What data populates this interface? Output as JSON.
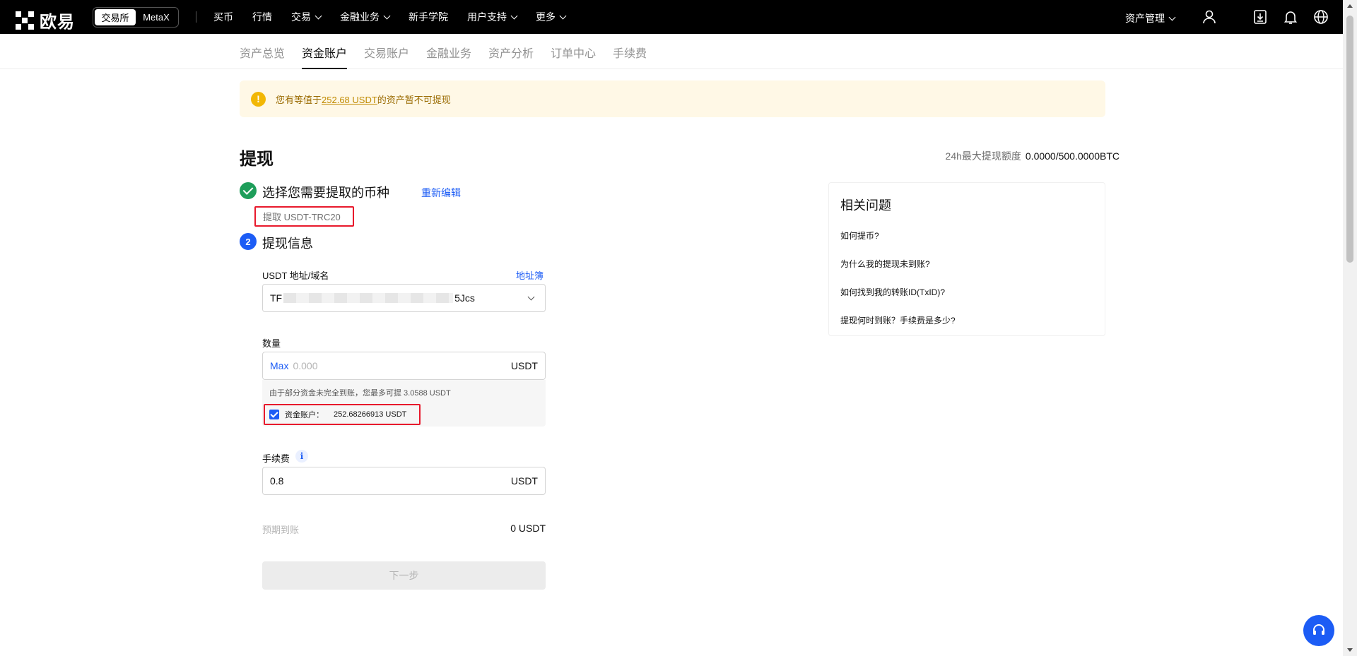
{
  "topnav": {
    "brand": "欧易",
    "switcher": [
      "交易所",
      "MetaX"
    ],
    "items": [
      {
        "label": "买币",
        "dropdown": false
      },
      {
        "label": "行情",
        "dropdown": false
      },
      {
        "label": "交易",
        "dropdown": true
      },
      {
        "label": "金融业务",
        "dropdown": true
      },
      {
        "label": "新手学院",
        "dropdown": false
      },
      {
        "label": "用户支持",
        "dropdown": true
      },
      {
        "label": "更多",
        "dropdown": true
      }
    ],
    "asset_mgmt": "资产管理",
    "icons": [
      "user-icon",
      "download-icon",
      "bell-icon",
      "globe-icon"
    ]
  },
  "subnav": {
    "tabs": [
      "资产总览",
      "资金账户",
      "交易账户",
      "金融业务",
      "资产分析",
      "订单中心",
      "手续费"
    ],
    "active_index": 1
  },
  "notice": {
    "prefix": "您有等值于",
    "amount": "252.68 USDT",
    "suffix": "的资产暂不可提现"
  },
  "page": {
    "title": "提现",
    "limit_label": "24h最大提现额度",
    "limit_value": "0.0000/500.0000BTC"
  },
  "step1": {
    "title": "选择您需要提取的币种",
    "reedit": "重新编辑",
    "selected": "提取 USDT-TRC20"
  },
  "step2": {
    "number": "2",
    "title": "提现信息",
    "address_label": "USDT 地址/域名",
    "address_book": "地址簿",
    "address_prefix": "TF",
    "address_suffix": "5Jcs",
    "amount_label": "数量",
    "max": "Max",
    "amount_placeholder": "0.000",
    "amount_unit": "USDT",
    "amount_note": "由于部分资金未完全到账，您最多可提 3.0588 USDT",
    "account_label": "资金账户：",
    "account_value": "252.68266913 USDT",
    "account_checked": true,
    "fee_label": "手续费",
    "fee_value": "0.8",
    "fee_unit": "USDT",
    "arrival_label": "预期到账",
    "arrival_value": "0 USDT",
    "next": "下一步"
  },
  "faq": {
    "title": "相关问题",
    "items": [
      "如何提币?",
      "为什么我的提现未到账?",
      "如何找到我的转账ID(TxID)?",
      "提现何时到账？手续费是多少?"
    ]
  },
  "colors": {
    "accent": "#1c5cf5",
    "success": "#1e9e5a",
    "warning_bg": "#fff8e6",
    "highlight_border": "#e8192c"
  }
}
